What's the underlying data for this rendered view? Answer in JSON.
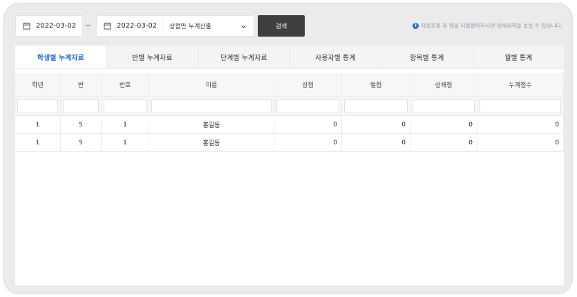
{
  "toolbar": {
    "start_date": "2022-03-02",
    "separator": "~",
    "end_date": "2022-03-02",
    "mode_select": "상점만 누계산출",
    "search_label": "검색",
    "notice": "자료조회 후 행을 더블클릭하시면 상세내역을 보실 수 있습니다."
  },
  "tabs": [
    {
      "label": "학생별 누계자료",
      "active": true
    },
    {
      "label": "반별 누계자료"
    },
    {
      "label": "단계별 누계자료"
    },
    {
      "label": "사용자별 통계"
    },
    {
      "label": "항목별 통계"
    },
    {
      "label": "월별 통계"
    }
  ],
  "table": {
    "columns": [
      "학년",
      "반",
      "번호",
      "이름",
      "상점",
      "벌점",
      "상쇄점",
      "누계점수"
    ],
    "rows": [
      [
        "1",
        "5",
        "1",
        "홍길동",
        "0",
        "0",
        "0",
        "0"
      ],
      [
        "1",
        "5",
        "1",
        "홍길동",
        "0",
        "0",
        "0",
        "0"
      ]
    ]
  },
  "colors": {
    "accent": "#2a6fd6",
    "button": "#3f3f41"
  }
}
